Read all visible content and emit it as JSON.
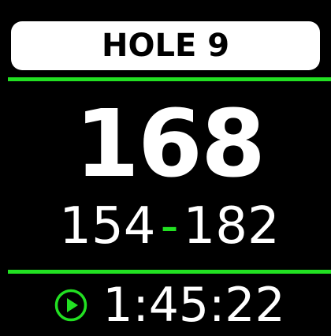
{
  "hole": {
    "label": "HOLE 9"
  },
  "distance": {
    "center": "168",
    "front": "154",
    "separator": "-",
    "back": "182"
  },
  "timer": {
    "icon": "play-icon",
    "elapsed": "1:45:22"
  },
  "colors": {
    "accent": "#22e022",
    "background": "#000000",
    "foreground": "#ffffff"
  }
}
